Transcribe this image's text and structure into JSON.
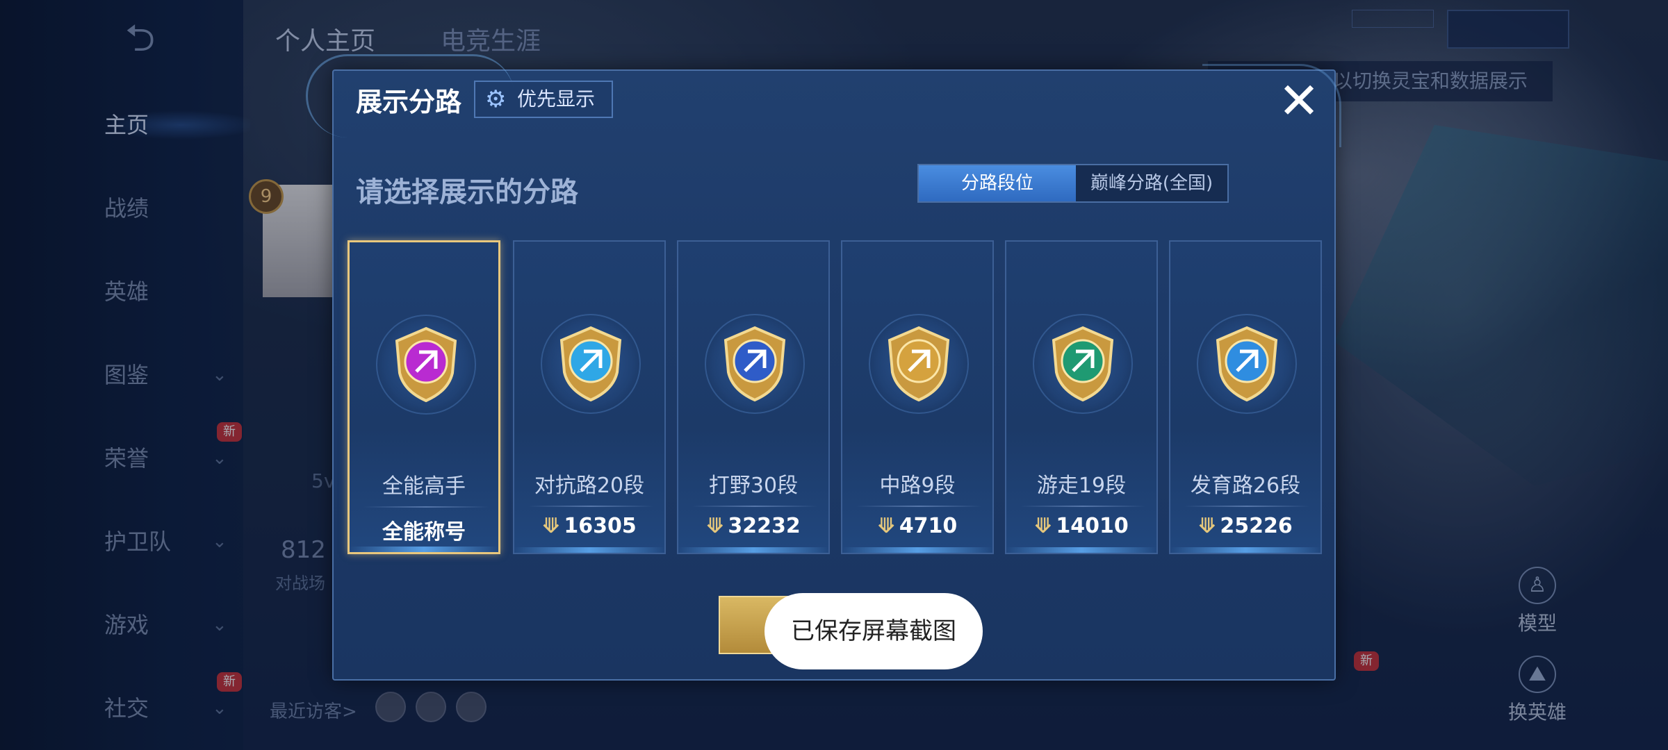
{
  "left_nav": {
    "back_icon": "back-arrow-icon",
    "items": [
      {
        "label": "主页",
        "active": true,
        "chevron": false,
        "new": false
      },
      {
        "label": "战绩",
        "active": false,
        "chevron": false,
        "new": false
      },
      {
        "label": "英雄",
        "active": false,
        "chevron": false,
        "new": false
      },
      {
        "label": "图鉴",
        "active": false,
        "chevron": true,
        "new": false
      },
      {
        "label": "荣誉",
        "active": false,
        "chevron": true,
        "new": true
      },
      {
        "label": "护卫队",
        "active": false,
        "chevron": true,
        "new": false
      },
      {
        "label": "游戏",
        "active": false,
        "chevron": true,
        "new": false
      },
      {
        "label": "社交",
        "active": false,
        "chevron": true,
        "new": true
      }
    ],
    "new_badge": "新"
  },
  "top_tabs": [
    "个人主页",
    "电竞生涯"
  ],
  "hint_banner": "以切换灵宝和数据展示",
  "background": {
    "level": "9",
    "score_number": "812",
    "score_sub": "对战场",
    "mode": "5v",
    "recent_visitors": "最近访客>"
  },
  "right_actions": [
    {
      "label": "模型",
      "icon": "model-icon"
    },
    {
      "label": "换英雄",
      "icon": "swap-hero-icon"
    }
  ],
  "modal": {
    "title": "展示分路",
    "priority_button": "优先显示",
    "heading": "请选择展示的分路",
    "toggle": {
      "selected": "分路段位",
      "other": "巅峰分路(全国)"
    },
    "close_icon": "close-icon",
    "cards": [
      {
        "name": "全能高手",
        "value": "全能称号",
        "selected": true,
        "medal_color": "#b92bd1",
        "has_score_icon": false
      },
      {
        "name": "对抗路20段",
        "value": "16305",
        "selected": false,
        "medal_color": "#2fa7e6",
        "has_score_icon": true
      },
      {
        "name": "打野30段",
        "value": "32232",
        "selected": false,
        "medal_color": "#2f5cc8",
        "has_score_icon": true
      },
      {
        "name": "中路9段",
        "value": "4710",
        "selected": false,
        "medal_color": "#d5a23e",
        "has_score_icon": true
      },
      {
        "name": "游走19段",
        "value": "14010",
        "selected": false,
        "medal_color": "#1f9a72",
        "has_score_icon": true
      },
      {
        "name": "发育路26段",
        "value": "25226",
        "selected": false,
        "medal_color": "#2f8de0",
        "has_score_icon": true
      }
    ]
  },
  "toast": "已保存屏幕截图",
  "colors": {
    "accent_gold": "#e8c77d",
    "toggle_blue": "#3f7fd6"
  }
}
